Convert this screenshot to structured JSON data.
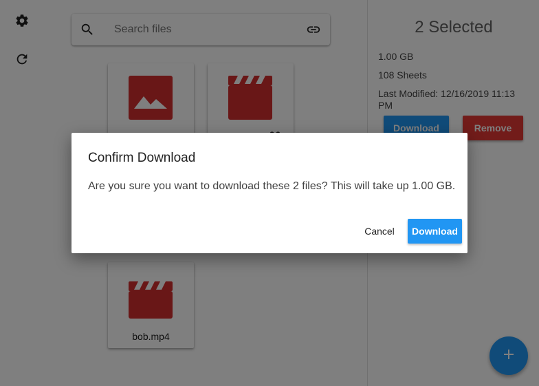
{
  "colors": {
    "file_icon_red": "#d32f2f",
    "download_blue": "#2196f3",
    "remove_red": "#e53935",
    "fab_blue": "#2196f3",
    "scrim": "rgba(0,0,0,0.5)"
  },
  "rail": {
    "items": [
      {
        "icon": "gear-icon"
      },
      {
        "icon": "refresh-icon"
      }
    ]
  },
  "search": {
    "placeholder": "Search files",
    "value": "",
    "icon": "search-icon",
    "link_icon": "link-icon"
  },
  "files": [
    {
      "name": "",
      "type": "image",
      "icon": "image-icon",
      "shared": false
    },
    {
      "name": "",
      "type": "video",
      "icon": "video-icon",
      "shared": true
    },
    {
      "name": "bob.mp4",
      "type": "video",
      "icon": "video-icon",
      "shared": false
    }
  ],
  "details": {
    "title": "2 Selected",
    "size": "1.00 GB",
    "sheets": "108 Sheets",
    "modified": "Last Modified: 12/16/2019 11:13 PM",
    "download_label": "Download",
    "remove_label": "Remove"
  },
  "fab": {
    "icon": "plus-icon"
  },
  "dialog": {
    "title": "Confirm Download",
    "message": "Are you sure you want to download these 2 files? This will take up 1.00 GB.",
    "cancel_label": "Cancel",
    "confirm_label": "Download"
  }
}
